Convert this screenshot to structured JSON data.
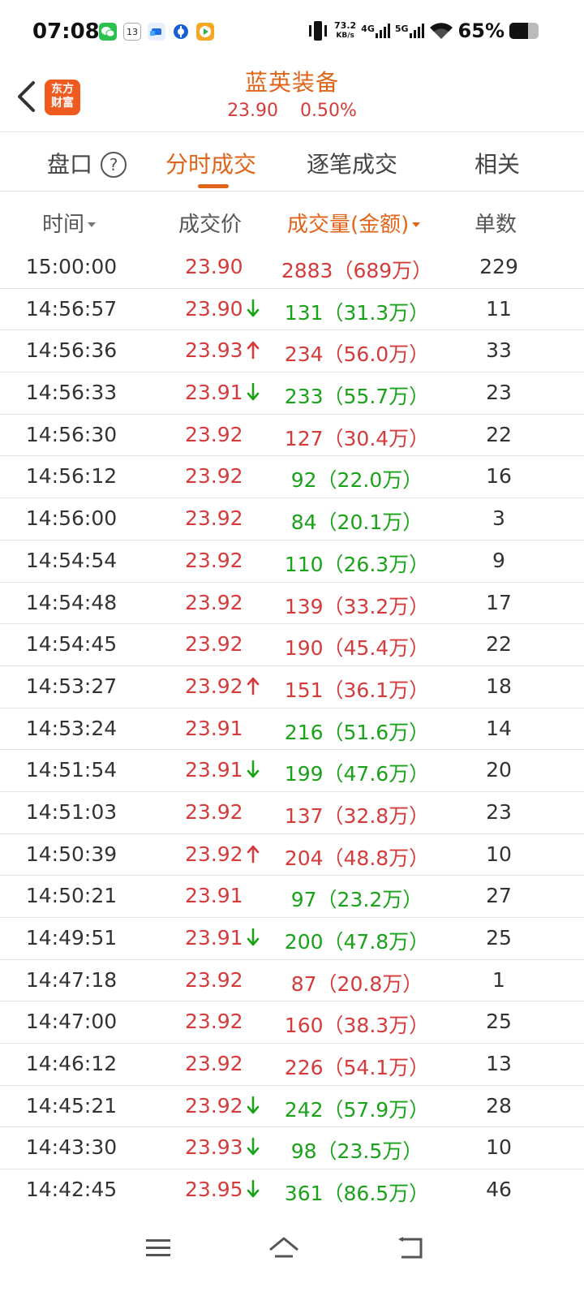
{
  "status_bar": {
    "time": "07:08",
    "net_speed_value": "73.2",
    "net_speed_unit": "KB/s",
    "signal1": "4G",
    "signal2": "5G",
    "battery": "65%",
    "battery_level": 0.65,
    "app_icons": [
      "wechat-icon",
      "calendar-icon",
      "cloud-app-icon",
      "bank-app-icon",
      "video-app-icon"
    ],
    "calendar_day": "13"
  },
  "header": {
    "logo_text_line1": "东方",
    "logo_text_line2": "财富",
    "stock_name": "蓝英装备",
    "price": "23.90",
    "change_pct": "0.50%"
  },
  "tabs": [
    {
      "label": "盘口",
      "active": false
    },
    {
      "label": "分时成交",
      "active": true
    },
    {
      "label": "逐笔成交",
      "active": false
    },
    {
      "label": "相关",
      "active": false
    }
  ],
  "help_icon_glyph": "?",
  "columns": {
    "time": "时间",
    "price": "成交价",
    "volume": "成交量(金额)",
    "count": "单数"
  },
  "colors": {
    "up": "#d63b3b",
    "down": "#1aa31a",
    "accent": "#e0641a"
  },
  "trades": [
    {
      "time": "15:00:00",
      "price": "23.90",
      "arrow": "",
      "volume": "2883（689万）",
      "vol_color": "red",
      "count": "229"
    },
    {
      "time": "14:56:57",
      "price": "23.90",
      "arrow": "down",
      "volume": "131（31.3万）",
      "vol_color": "green",
      "count": "11"
    },
    {
      "time": "14:56:36",
      "price": "23.93",
      "arrow": "up",
      "volume": "234（56.0万）",
      "vol_color": "red",
      "count": "33"
    },
    {
      "time": "14:56:33",
      "price": "23.91",
      "arrow": "down",
      "volume": "233（55.7万）",
      "vol_color": "green",
      "count": "23"
    },
    {
      "time": "14:56:30",
      "price": "23.92",
      "arrow": "",
      "volume": "127（30.4万）",
      "vol_color": "red",
      "count": "22"
    },
    {
      "time": "14:56:12",
      "price": "23.92",
      "arrow": "",
      "volume": "92（22.0万）",
      "vol_color": "green",
      "count": "16"
    },
    {
      "time": "14:56:00",
      "price": "23.92",
      "arrow": "",
      "volume": "84（20.1万）",
      "vol_color": "green",
      "count": "3"
    },
    {
      "time": "14:54:54",
      "price": "23.92",
      "arrow": "",
      "volume": "110（26.3万）",
      "vol_color": "green",
      "count": "9"
    },
    {
      "time": "14:54:48",
      "price": "23.92",
      "arrow": "",
      "volume": "139（33.2万）",
      "vol_color": "red",
      "count": "17"
    },
    {
      "time": "14:54:45",
      "price": "23.92",
      "arrow": "",
      "volume": "190（45.4万）",
      "vol_color": "red",
      "count": "22"
    },
    {
      "time": "14:53:27",
      "price": "23.92",
      "arrow": "up",
      "volume": "151（36.1万）",
      "vol_color": "red",
      "count": "18"
    },
    {
      "time": "14:53:24",
      "price": "23.91",
      "arrow": "",
      "volume": "216（51.6万）",
      "vol_color": "green",
      "count": "14"
    },
    {
      "time": "14:51:54",
      "price": "23.91",
      "arrow": "down",
      "volume": "199（47.6万）",
      "vol_color": "green",
      "count": "20"
    },
    {
      "time": "14:51:03",
      "price": "23.92",
      "arrow": "",
      "volume": "137（32.8万）",
      "vol_color": "red",
      "count": "23"
    },
    {
      "time": "14:50:39",
      "price": "23.92",
      "arrow": "up",
      "volume": "204（48.8万）",
      "vol_color": "red",
      "count": "10"
    },
    {
      "time": "14:50:21",
      "price": "23.91",
      "arrow": "",
      "volume": "97（23.2万）",
      "vol_color": "green",
      "count": "27"
    },
    {
      "time": "14:49:51",
      "price": "23.91",
      "arrow": "down",
      "volume": "200（47.8万）",
      "vol_color": "green",
      "count": "25"
    },
    {
      "time": "14:47:18",
      "price": "23.92",
      "arrow": "",
      "volume": "87（20.8万）",
      "vol_color": "red",
      "count": "1"
    },
    {
      "time": "14:47:00",
      "price": "23.92",
      "arrow": "",
      "volume": "160（38.3万）",
      "vol_color": "red",
      "count": "25"
    },
    {
      "time": "14:46:12",
      "price": "23.92",
      "arrow": "",
      "volume": "226（54.1万）",
      "vol_color": "red",
      "count": "13"
    },
    {
      "time": "14:45:21",
      "price": "23.92",
      "arrow": "down",
      "volume": "242（57.9万）",
      "vol_color": "green",
      "count": "28"
    },
    {
      "time": "14:43:30",
      "price": "23.93",
      "arrow": "down",
      "volume": "98（23.5万）",
      "vol_color": "green",
      "count": "10"
    },
    {
      "time": "14:42:45",
      "price": "23.95",
      "arrow": "down",
      "volume": "361（86.5万）",
      "vol_color": "green",
      "count": "46"
    }
  ],
  "nav_bar": [
    "menu-icon",
    "home-icon",
    "back-icon"
  ]
}
